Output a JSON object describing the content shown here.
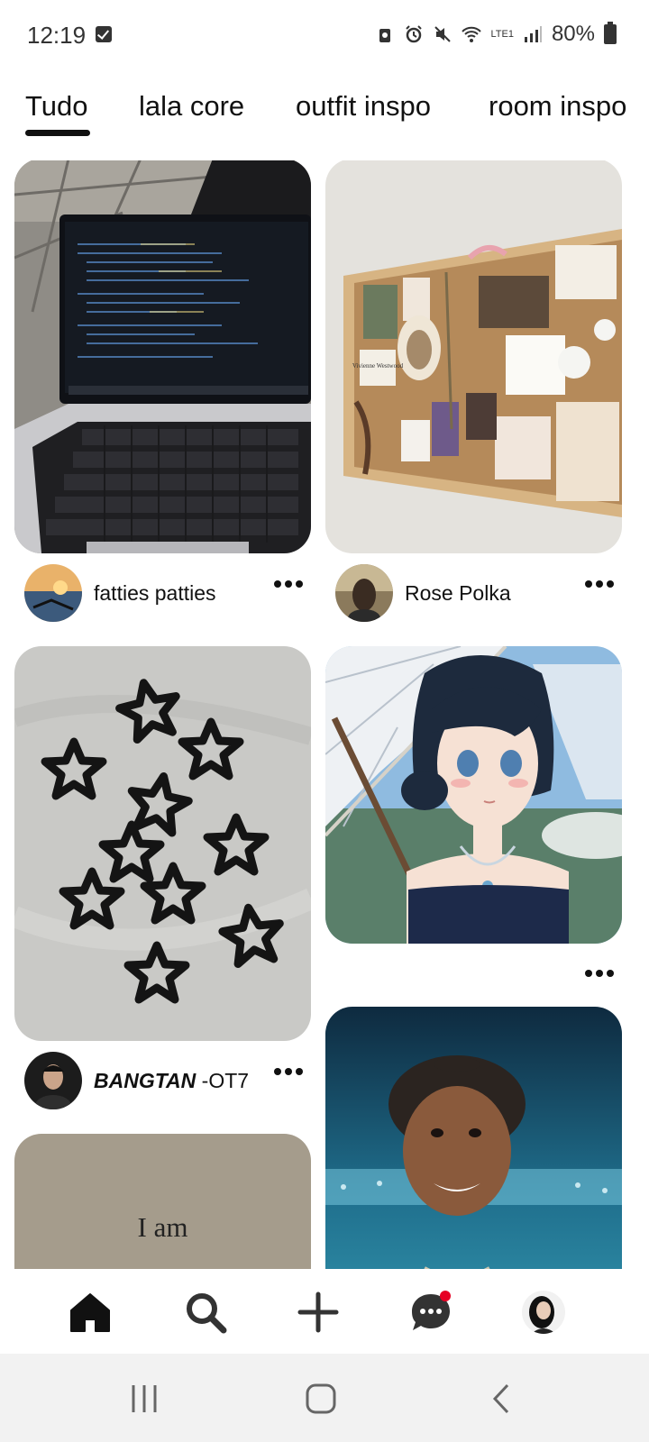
{
  "status_bar": {
    "time": "12:19",
    "network": "LTE1",
    "battery": "80%",
    "icons": [
      "checkbox-notification-icon",
      "lock-battery-icon",
      "alarm-icon",
      "mute-icon",
      "wifi-icon",
      "volte-icon",
      "signal-icon",
      "battery-icon"
    ]
  },
  "tabs": [
    {
      "label": "Tudo",
      "active": true
    },
    {
      "label": "lala core",
      "active": false
    },
    {
      "label": "outfit inspo",
      "active": false
    },
    {
      "label": "room inspo",
      "active": false
    }
  ],
  "pins": [
    {
      "id": "laptop",
      "user": "fatties patties",
      "image": "laptop-code-photo"
    },
    {
      "id": "corkboard",
      "user": "Rose Polka",
      "image": "corkboard-collage-photo",
      "board_text": "Vivienne Westwood"
    },
    {
      "id": "stars",
      "user_bold": "BANGTAN",
      "user_suffix": " -OT7",
      "image": "star-hairclips-photo"
    },
    {
      "id": "anime",
      "user": "",
      "image": "anime-girl-parasol-illustration"
    },
    {
      "id": "quote",
      "image": "quote-card",
      "text": "I am"
    },
    {
      "id": "portrait",
      "image": "man-in-beret-portrait"
    }
  ],
  "bottom_nav": {
    "items": [
      "home-icon",
      "search-icon",
      "add-icon",
      "messages-icon",
      "profile-avatar"
    ],
    "badge_color": "#e60023"
  },
  "system_nav": [
    "recents-button",
    "home-button",
    "back-button"
  ],
  "colors": {
    "accent": "#e60023",
    "text": "#111111"
  }
}
